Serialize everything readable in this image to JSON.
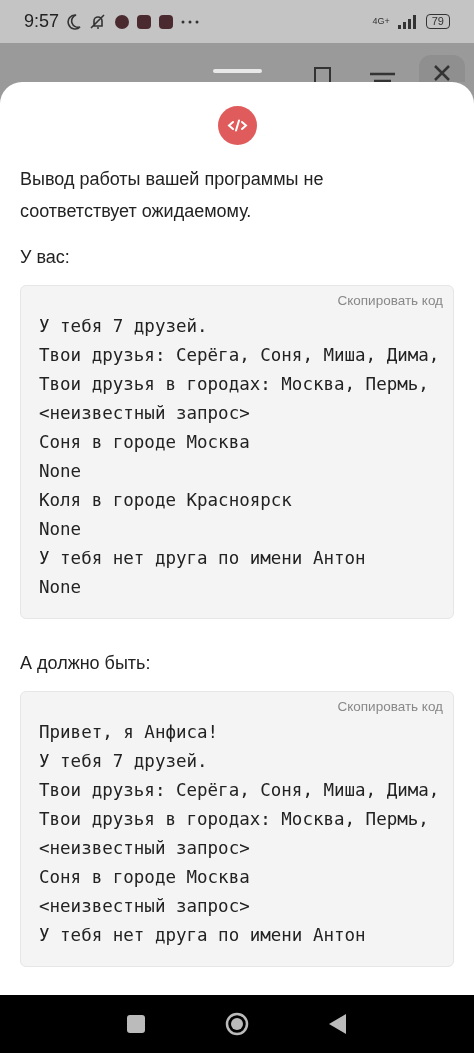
{
  "status_bar": {
    "time": "9:57",
    "network": "4G+",
    "battery": "79"
  },
  "sheet": {
    "message": "Вывод работы вашей программы не соответствует ожидаемому.",
    "outputs": [
      {
        "label": "У вас:",
        "copy_button": "Скопировать код",
        "lines": [
          "У тебя 7 друзей.",
          "Твои друзья: Серёга, Соня, Миша, Дима,",
          "Твои друзья в городах: Москва, Пермь,",
          "<неизвестный запрос>",
          "Соня в городе Москва",
          "None",
          "Коля в городе Красноярск",
          "None",
          "У тебя нет друга по имени Антон",
          "None"
        ]
      },
      {
        "label": "А должно быть:",
        "copy_button": "Скопировать код",
        "lines": [
          "Привет, я Анфиса!",
          "У тебя 7 друзей.",
          "Твои друзья: Серёга, Соня, Миша, Дима,",
          "Твои друзья в городах: Москва, Пермь,",
          "<неизвестный запрос>",
          "Соня в городе Москва",
          "<неизвестный запрос>",
          "У тебя нет друга по имени Антон"
        ]
      }
    ]
  }
}
